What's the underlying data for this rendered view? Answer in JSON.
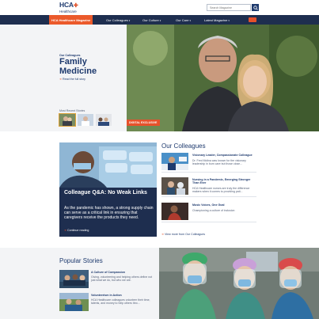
{
  "header": {
    "logo_main": "HCA",
    "logo_sub": "Healthcare",
    "search_placeholder": "Search Magazine",
    "accent_color": "#e6512b",
    "brand_color": "#1e2e4f"
  },
  "nav": {
    "items": [
      {
        "label": "HCA Healthcare Magazine"
      },
      {
        "label": "Our Colleagues"
      },
      {
        "label": "Our Culture"
      },
      {
        "label": "Our Care"
      },
      {
        "label": "Latest Magazine"
      }
    ]
  },
  "hero": {
    "kicker": "Our Colleagues",
    "title": "Family Medicine",
    "link": "Read the full story",
    "recent_label": "Most Recent Stories",
    "badge": "DIGITAL EXCLUSIVE"
  },
  "feature": {
    "title": "Colleague Q&A: No Weak Links",
    "text": "As the pandemic has shown, a strong supply chain can serve as a critical link in ensuring that caregivers receive the products they need.",
    "link": "Continue reading"
  },
  "colleagues": {
    "title": "Our Colleagues",
    "items": [
      {
        "title": "Visionary Leader, Compassionate Colleague",
        "text": "Dr. Fred Molina was known for the visionary leadership in burn care but those close..."
      },
      {
        "title": "Nursing in a Pandemic, Emerging Stronger Than Ever",
        "text": "HCA Healthcare nurses are truly the difference makers when it comes to providing pati..."
      },
      {
        "title": "Music Voices, One Goal",
        "text": "Championing a culture of inclusion"
      }
    ],
    "view_more": "View more from Our Colleagues"
  },
  "popular": {
    "title": "Popular Stories",
    "items": [
      {
        "title": "A Culture of Compassion",
        "text": "Giving, volunteering and helping others define not just what we do, but who we are."
      },
      {
        "title": "Volunteerism in Action",
        "text": "HCA Healthcare colleagues volunteer their time, talents, and money to help others thro..."
      }
    ]
  }
}
